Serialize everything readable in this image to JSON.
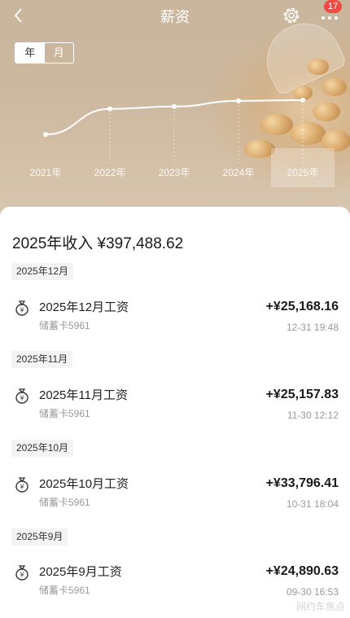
{
  "nav": {
    "title": "薪资",
    "badge": "17"
  },
  "toggle": {
    "year": "年",
    "month": "月"
  },
  "chart_data": {
    "type": "line",
    "x": [
      "2021年",
      "2022年",
      "2023年",
      "2024年",
      "2025年"
    ],
    "y": [
      0.08,
      0.72,
      0.78,
      0.92,
      0.94
    ],
    "note_units": "relative trend",
    "selected": "2025年",
    "line_color": "#ffffff"
  },
  "summary": {
    "text": "2025年收入 ¥397,488.62"
  },
  "groups": [
    {
      "month": "2025年12月",
      "name": "2025年12月工资",
      "card": "储蓄卡5961",
      "amount": "+¥25,168.16",
      "time": "12-31 19:48"
    },
    {
      "month": "2025年11月",
      "name": "2025年11月工资",
      "card": "储蓄卡5961",
      "amount": "+¥25,157.83",
      "time": "11-30 12:12"
    },
    {
      "month": "2025年10月",
      "name": "2025年10月工资",
      "card": "储蓄卡5961",
      "amount": "+¥33,796.41",
      "time": "10-31 18:04"
    },
    {
      "month": "2025年9月",
      "name": "2025年9月工资",
      "card": "储蓄卡5961",
      "amount": "+¥24,890.63",
      "time": "09-30 16:53"
    }
  ],
  "watermark": "网约车焦点",
  "colors": {
    "header": "#cdb9a0",
    "badge": "#ef4b45"
  }
}
